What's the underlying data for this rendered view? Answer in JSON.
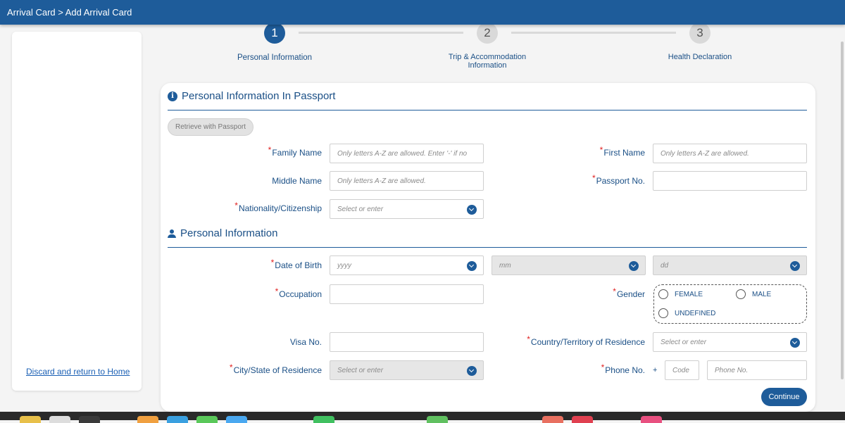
{
  "header": {
    "breadcrumb": "Arrival Card > Add Arrival Card"
  },
  "sidebar": {
    "discard_link": "Discard and return to Home"
  },
  "stepper": {
    "steps": [
      {
        "number": "1",
        "label": "Personal Information",
        "state": "active"
      },
      {
        "number": "2",
        "label_line1": "Trip & Accommodation",
        "label_line2": "Information",
        "state": "inactive"
      },
      {
        "number": "3",
        "label": "Health Declaration",
        "state": "inactive"
      }
    ]
  },
  "passport_section": {
    "title": "Personal Information In Passport",
    "retrieve_button": "Retrieve with Passport",
    "family_name": {
      "label": "Family Name",
      "required": true,
      "placeholder": "Only letters A-Z are allowed. Enter '-' if no"
    },
    "first_name": {
      "label": "First Name",
      "required": true,
      "placeholder": "Only letters A-Z are allowed."
    },
    "middle_name": {
      "label": "Middle Name",
      "required": false,
      "placeholder": "Only letters A-Z are allowed."
    },
    "passport_no": {
      "label": "Passport No.",
      "required": true,
      "placeholder": ""
    },
    "nationality": {
      "label": "Nationality/Citizenship",
      "required": true,
      "placeholder": "Select or enter"
    }
  },
  "personal_section": {
    "title": "Personal Information",
    "dob": {
      "label": "Date of Birth",
      "required": true,
      "year_placeholder": "yyyy",
      "month_placeholder": "mm",
      "day_placeholder": "dd"
    },
    "occupation": {
      "label": "Occupation",
      "required": true
    },
    "gender": {
      "label": "Gender",
      "required": true,
      "options": [
        "FEMALE",
        "MALE",
        "UNDEFINED"
      ]
    },
    "visa_no": {
      "label": "Visa No.",
      "required": false
    },
    "country_residence": {
      "label": "Country/Territory of Residence",
      "required": true,
      "placeholder": "Select or enter"
    },
    "city_residence": {
      "label": "City/State of Residence",
      "required": true,
      "placeholder": "Select or enter"
    },
    "phone": {
      "label": "Phone No.",
      "required": true,
      "plus": "+",
      "code_placeholder": "Code",
      "number_placeholder": "Phone No."
    }
  },
  "actions": {
    "continue": "Continue"
  },
  "colors": {
    "brand": "#1e5c9a",
    "required": "#e02020",
    "text": "#1a4f86"
  }
}
